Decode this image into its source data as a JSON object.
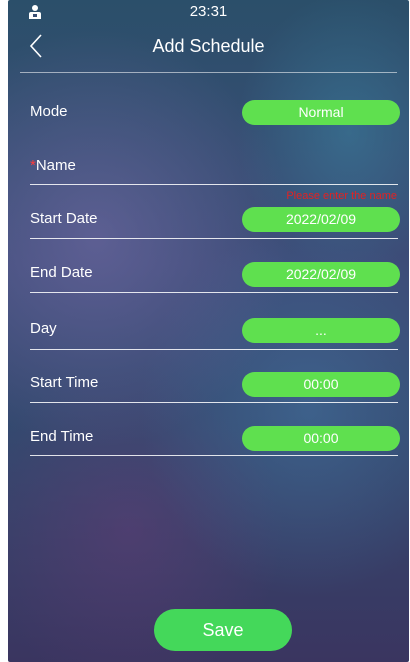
{
  "status_bar": {
    "time": "23:31",
    "icon": "user-badge-icon"
  },
  "header": {
    "title": "Add Schedule",
    "back_icon": "chevron-left-icon"
  },
  "form": {
    "mode": {
      "label": "Mode",
      "value": "Normal"
    },
    "name": {
      "required_mark": "*",
      "label": "Name",
      "value": "",
      "error": "Please enter the name"
    },
    "start_date": {
      "label": "Start Date",
      "value": "2022/02/09"
    },
    "end_date": {
      "label": "End Date",
      "value": "2022/02/09"
    },
    "day": {
      "label": "Day",
      "value": "..."
    },
    "start_time": {
      "label": "Start Time",
      "value": "00:00"
    },
    "end_time": {
      "label": "End Time",
      "value": "00:00"
    }
  },
  "save_label": "Save",
  "colors": {
    "pill": "#5fe04f",
    "save": "#44d85a",
    "error": "#e32222"
  }
}
